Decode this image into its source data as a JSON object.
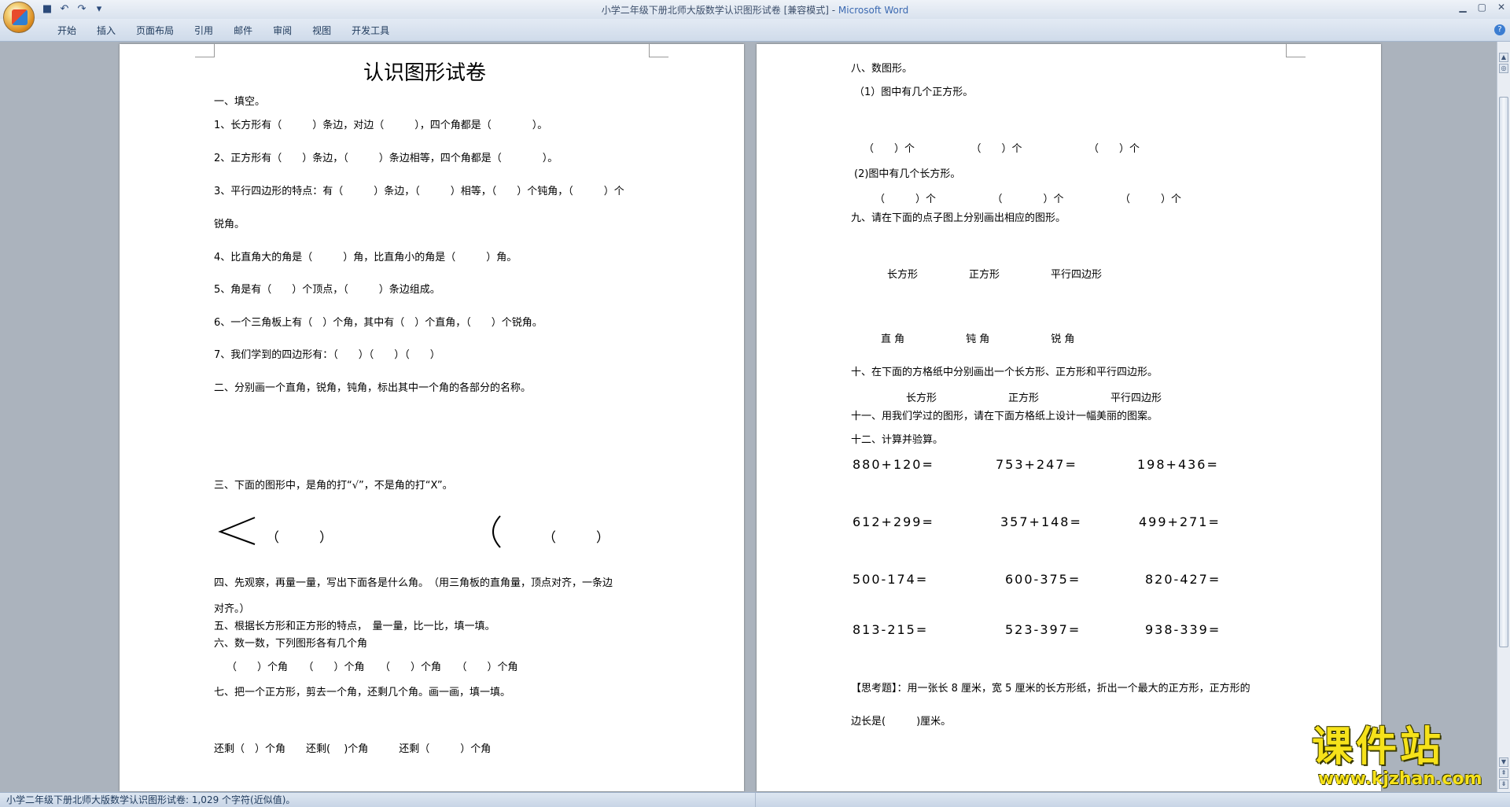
{
  "window": {
    "doc_name": "小学二年级下册北师大版数学认识图形试卷 [兼容模式] - ",
    "app_name": "Microsoft Word"
  },
  "ribbon": {
    "tabs": [
      "开始",
      "插入",
      "页面布局",
      "引用",
      "邮件",
      "审阅",
      "视图",
      "开发工具"
    ]
  },
  "page1": {
    "title": "认识图形试卷",
    "lines": [
      "一、填空。",
      "1、长方形有（　　　）条边，对边（　　　），四个角都是（　　　　）。",
      "2、正方形有（　　）条边，（　　　）条边相等，四个角都是（　　　　）。",
      "3、平行四边形的特点：有（　　　）条边，（　　　）相等，（　　）个钝角，（　　　）个",
      "锐角。",
      "4、比直角大的角是（　　　）角，比直角小的角是（　　　）角。",
      "5、角是有（　　）个顶点，（　　　）条边组成。",
      "6、一个三角板上有（　）个角，其中有（　）个直角，（　　）个锐角。",
      "7、我们学到的四边形有：（　　）（　　）（　　）",
      "二、分别画一个直角，锐角，钝角，标出其中一个角的各部分的名称。",
      "三、下面的图形中，是角的打“√”，不是角的打“X”。",
      "（　　　）",
      "（　　　）",
      "四、先观察，再量一量，写出下面各是什么角。　（用三角板的直角量，顶点对齐，一条边",
      "对齐。）",
      "五、根据长方形和正方形的特点，　量一量，比一比，填一填。",
      "六、数一数，下列图形各有几个角",
      "（　　）个角　　（　　）个角　　（　　）个角　　（　　）个角",
      "七、把一个正方形，剪去一个角，还剩几个角。画一画，填一填。",
      "还剩（　）个角　　还剩(　 )个角　　　还剩（　　　）个角"
    ]
  },
  "page2": {
    "lines": [
      "八、数图形。",
      "（1）图中有几个正方形。",
      "（　　）个　　　　　　（　　）个　　　　　　　（　　）个",
      "(2)图中有几个长方形。",
      "（　　　）个　　　　　　（　　　　）个　　　　　　（　　　）个",
      "九、请在下面的点子图上分别画出相应的图形。",
      "长方形　　　　　正方形　　　　　平行四边形",
      "直 角　　　　　　钝 角　　　　　　锐 角",
      "十、在下面的方格纸中分别画出一个长方形、正方形和平行四边形。",
      "长方形　　　　　　　正方形　　　　　　　平行四边形",
      "十一、用我们学过的图形，请在下面方格纸上设计一幅美丽的图案。",
      "十二、计算并验算。",
      "【思考题】：用一张长 8 厘米，宽 5 厘米的长方形纸，折出一个最大的正方形，正方形的",
      "边长是(　　　)厘米。"
    ],
    "calcs": [
      [
        "880+120=",
        "753+247=",
        "198+436="
      ],
      [
        "612+299=",
        "357+148=",
        "499+271="
      ],
      [
        "500-174=",
        "600-375=",
        "820-427="
      ],
      [
        "813-215=",
        "523-397=",
        "938-339="
      ]
    ]
  },
  "status": {
    "text": "小学二年级下册北师大版数学认识图形试卷: 1,029 个字符(近似值)。"
  },
  "watermark": {
    "cn": "课件站",
    "url": "www.kjzhan.com"
  },
  "icons": [
    "office-button-icon",
    "save-icon",
    "undo-icon",
    "redo-icon",
    "customize-icon",
    "minimize-icon",
    "maximize-icon",
    "close-icon",
    "help-icon"
  ]
}
